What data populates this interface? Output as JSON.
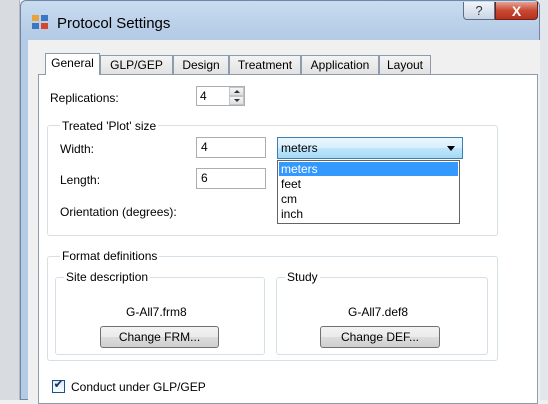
{
  "window": {
    "title": "Protocol Settings",
    "help_label": "?",
    "close_label": "X",
    "icon": "grid-app-icon"
  },
  "tabs": [
    {
      "label": "General",
      "active": true
    },
    {
      "label": "GLP/GEP",
      "active": false
    },
    {
      "label": "Design",
      "active": false
    },
    {
      "label": "Treatment",
      "active": false
    },
    {
      "label": "Application",
      "active": false
    },
    {
      "label": "Layout",
      "active": false
    }
  ],
  "general": {
    "replications_label": "Replications:",
    "replications_value": "4",
    "plot_size": {
      "group_title": "Treated 'Plot' size",
      "width_label": "Width:",
      "width_value": "4",
      "length_label": "Length:",
      "length_value": "6",
      "orientation_label": "Orientation (degrees):",
      "units_selected": "meters",
      "units_options": [
        "meters",
        "feet",
        "cm",
        "inch"
      ]
    },
    "format_definitions": {
      "group_title": "Format definitions",
      "site": {
        "title": "Site description",
        "file": "G-All7.frm8",
        "button": "Change FRM..."
      },
      "study": {
        "title": "Study",
        "file": "G-All7.def8",
        "button": "Change DEF..."
      }
    },
    "glp_checkbox_label": "Conduct under GLP/GEP",
    "glp_checked": true,
    "check_mark": "✔"
  },
  "colors": {
    "selection": "#3399ff",
    "titlebar": "#b9cfe7",
    "close_button": "#c74a33"
  }
}
